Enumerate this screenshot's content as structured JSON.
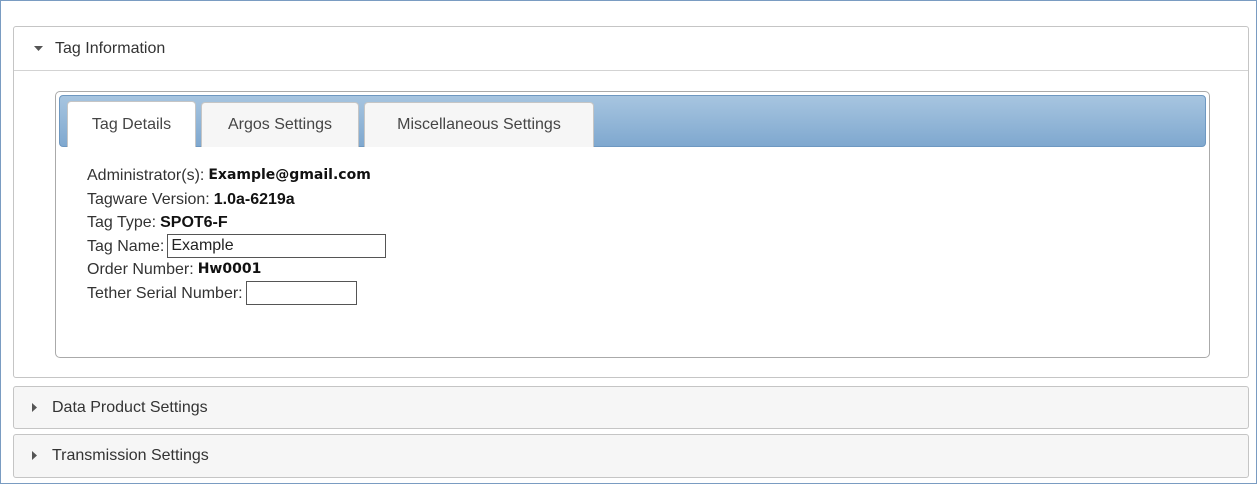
{
  "panels": {
    "tag_information": {
      "label": "Tag Information",
      "expanded": true
    },
    "data_product_settings": {
      "label": "Data Product Settings",
      "expanded": false
    },
    "transmission_settings": {
      "label": "Transmission Settings",
      "expanded": false
    }
  },
  "tabs": [
    {
      "label": "Tag Details",
      "active": true
    },
    {
      "label": "Argos Settings",
      "active": false
    },
    {
      "label": "Miscellaneous Settings",
      "active": false
    }
  ],
  "tag_details": {
    "administrators_label": "Administrator(s):",
    "administrators_value": "Example@gmail.com",
    "tagware_version_label": "Tagware Version:",
    "tagware_version_value": "1.0a-6219a",
    "tag_type_label": "Tag Type:",
    "tag_type_value": "SPOT6-F",
    "tag_name_label": "Tag Name:",
    "tag_name_value": "Example",
    "order_number_label": "Order Number:",
    "order_number_value": "Hw0001",
    "tether_serial_label": "Tether Serial Number:",
    "tether_serial_value": ""
  },
  "icons": {
    "expanded": "caret-down-icon",
    "collapsed": "caret-right-icon"
  },
  "colors": {
    "tab_bar_top": "#a7c5e0",
    "tab_bar_bottom": "#7fa8cf",
    "border": "#c5c5c5"
  }
}
